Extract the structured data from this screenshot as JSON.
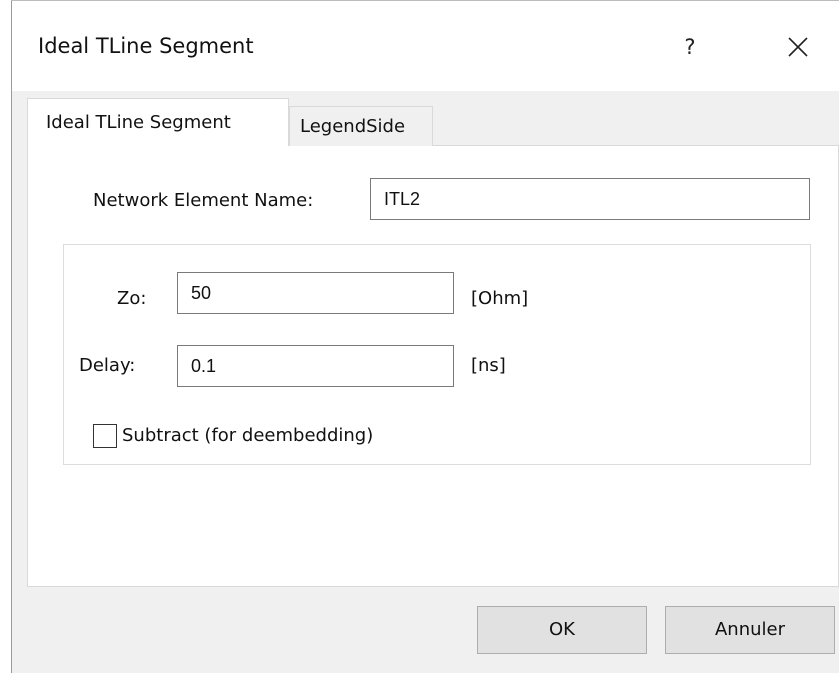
{
  "window": {
    "title": "Ideal TLine Segment",
    "help_label": "?",
    "close_icon": "close-icon"
  },
  "tabs": [
    {
      "label": "Ideal TLine Segment",
      "active": true
    },
    {
      "label": "LegendSide",
      "active": false
    }
  ],
  "form": {
    "name_label": "Network Element Name:",
    "name_value": "ITL2",
    "zo_label": "Zo:",
    "zo_value": "50",
    "zo_unit": "[Ohm]",
    "delay_label": "Delay:",
    "delay_value": "0.1",
    "delay_unit": "[ns]",
    "subtract_label": "Subtract (for deembedding)",
    "subtract_checked": false
  },
  "buttons": {
    "ok_label": "OK",
    "cancel_label": "Annuler"
  }
}
